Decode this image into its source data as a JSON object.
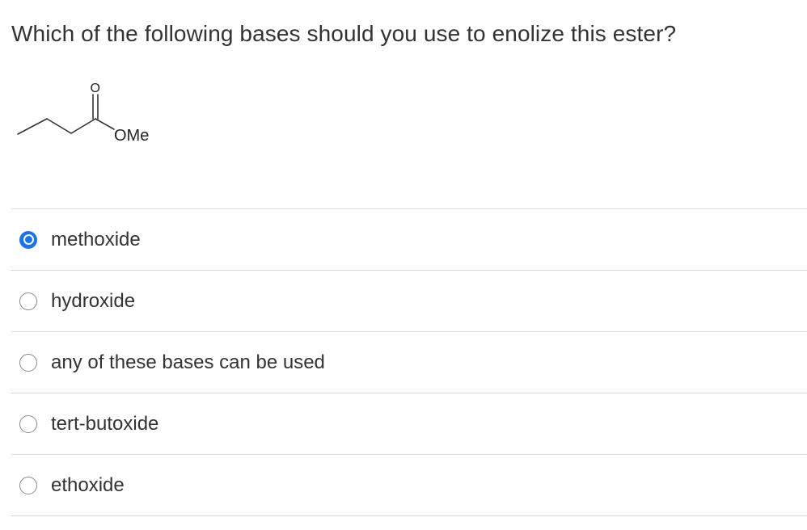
{
  "question": {
    "text": "Which of the following bases should you use to enolize this ester?"
  },
  "structure": {
    "carbonyl_oxygen_label": "O",
    "ester_group_label": "OMe"
  },
  "options": [
    {
      "label": "methoxide",
      "selected": true
    },
    {
      "label": "hydroxide",
      "selected": false
    },
    {
      "label": "any of these bases can be used",
      "selected": false
    },
    {
      "label": "tert-butoxide",
      "selected": false
    },
    {
      "label": "ethoxide",
      "selected": false
    }
  ],
  "colors": {
    "accent": "#1a73e8",
    "text": "#333333",
    "divider": "#d6d6d6"
  }
}
